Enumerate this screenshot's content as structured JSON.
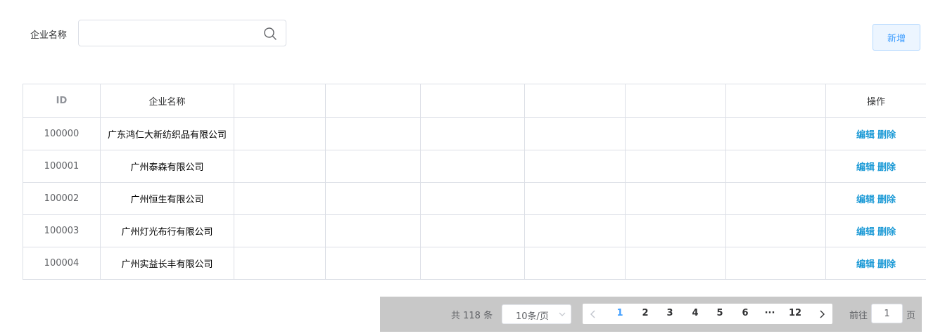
{
  "search": {
    "label": "企业名称",
    "value": "",
    "placeholder": ""
  },
  "add_button": "新增",
  "table": {
    "headers": [
      "ID",
      "企业名称",
      "",
      "",
      "",
      "",
      "",
      "",
      "操作"
    ],
    "rows": [
      {
        "id": "100000",
        "name": "广东鸿仁大新纺织品有限公司",
        "edit": "编辑",
        "delete": "删除"
      },
      {
        "id": "100001",
        "name": "广州泰森有限公司",
        "edit": "编辑",
        "delete": "删除"
      },
      {
        "id": "100002",
        "name": "广州恒生有限公司",
        "edit": "编辑",
        "delete": "删除"
      },
      {
        "id": "100003",
        "name": "广州灯光布行有限公司",
        "edit": "编辑",
        "delete": "删除"
      },
      {
        "id": "100004",
        "name": "广州实益长丰有限公司",
        "edit": "编辑",
        "delete": "删除"
      }
    ]
  },
  "pagination": {
    "total": "共 118 条",
    "page_size": "10条/页",
    "pages": [
      "1",
      "2",
      "3",
      "4",
      "5",
      "6",
      "···",
      "12"
    ],
    "current_page": "1",
    "goto_label": "前往",
    "goto_value": "1",
    "page_unit": "页",
    "prev_icon": "chevron-left-icon",
    "next_icon": "chevron-right-icon"
  },
  "colors": {
    "primary": "#409eff",
    "link": "#1c9ad6",
    "pager_bg": "#c8c8c8",
    "border": "#dcdfe6"
  }
}
